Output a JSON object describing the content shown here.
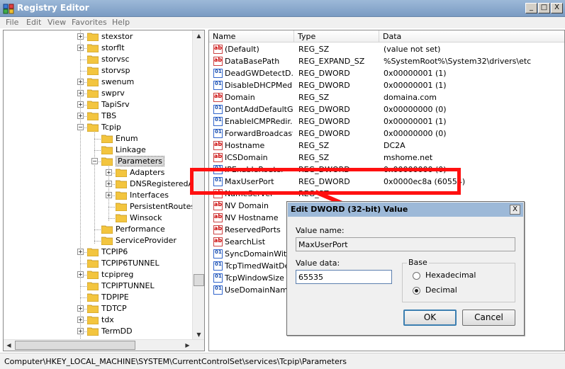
{
  "window": {
    "title": "Registry Editor",
    "buttons": {
      "minimize": "_",
      "maximize": "□",
      "close": "X"
    }
  },
  "menu": [
    "File",
    "Edit",
    "View",
    "Favorites",
    "Help"
  ],
  "tree": {
    "items": [
      {
        "label": "stexstor",
        "expander": "+"
      },
      {
        "label": "storflt",
        "expander": "+"
      },
      {
        "label": "storvsc",
        "expander": ""
      },
      {
        "label": "storvsp",
        "expander": ""
      },
      {
        "label": "swenum",
        "expander": "+"
      },
      {
        "label": "swprv",
        "expander": "+"
      },
      {
        "label": "TapiSrv",
        "expander": "+"
      },
      {
        "label": "TBS",
        "expander": "+"
      },
      {
        "label": "Tcpip",
        "expander": "−"
      },
      {
        "label": "Enum",
        "expander": ""
      },
      {
        "label": "Linkage",
        "expander": ""
      },
      {
        "label": "Parameters",
        "expander": "−"
      },
      {
        "label": "Adapters",
        "expander": "+"
      },
      {
        "label": "DNSRegisteredAd",
        "expander": "+"
      },
      {
        "label": "Interfaces",
        "expander": "+"
      },
      {
        "label": "PersistentRoutes",
        "expander": ""
      },
      {
        "label": "Winsock",
        "expander": ""
      },
      {
        "label": "Performance",
        "expander": ""
      },
      {
        "label": "ServiceProvider",
        "expander": ""
      },
      {
        "label": "TCPIP6",
        "expander": "+"
      },
      {
        "label": "TCPIP6TUNNEL",
        "expander": ""
      },
      {
        "label": "tcpipreg",
        "expander": "+"
      },
      {
        "label": "TCPIPTUNNEL",
        "expander": ""
      },
      {
        "label": "TDPIPE",
        "expander": ""
      },
      {
        "label": "TDTCP",
        "expander": "+"
      },
      {
        "label": "tdx",
        "expander": "+"
      },
      {
        "label": "TermDD",
        "expander": "+"
      }
    ],
    "selected": "Parameters"
  },
  "values_pane": {
    "columns": [
      "Name",
      "Type",
      "Data"
    ],
    "rows": [
      {
        "name": "(Default)",
        "type": "REG_SZ",
        "data": "(value not set)",
        "icon": "string-value-icon"
      },
      {
        "name": "DataBasePath",
        "type": "REG_EXPAND_SZ",
        "data": "%SystemRoot%\\System32\\drivers\\etc",
        "icon": "string-value-icon"
      },
      {
        "name": "DeadGWDetectD...",
        "type": "REG_DWORD",
        "data": "0x00000001 (1)",
        "icon": "dword-value-icon"
      },
      {
        "name": "DisableDHCPMedi...",
        "type": "REG_DWORD",
        "data": "0x00000001 (1)",
        "icon": "dword-value-icon"
      },
      {
        "name": "Domain",
        "type": "REG_SZ",
        "data": "domaina.com",
        "icon": "string-value-icon"
      },
      {
        "name": "DontAddDefaultG...",
        "type": "REG_DWORD",
        "data": "0x00000000 (0)",
        "icon": "dword-value-icon"
      },
      {
        "name": "EnableICMPRedir...",
        "type": "REG_DWORD",
        "data": "0x00000001 (1)",
        "icon": "dword-value-icon"
      },
      {
        "name": "ForwardBroadcasts",
        "type": "REG_DWORD",
        "data": "0x00000000 (0)",
        "icon": "dword-value-icon"
      },
      {
        "name": "Hostname",
        "type": "REG_SZ",
        "data": "DC2A",
        "icon": "string-value-icon"
      },
      {
        "name": "ICSDomain",
        "type": "REG_SZ",
        "data": "mshome.net",
        "icon": "string-value-icon"
      },
      {
        "name": "IPEnableRouter",
        "type": "REG_DWORD",
        "data": "0x00000000 (0)",
        "icon": "dword-value-icon"
      },
      {
        "name": "MaxUserPort",
        "type": "REG_DWORD",
        "data": "0x0000ec8a (60554)",
        "icon": "dword-value-icon"
      },
      {
        "name": "NameServer",
        "type": "REG_SZ",
        "data": "",
        "icon": "string-value-icon"
      },
      {
        "name": "NV Domain",
        "type": "",
        "data": "",
        "icon": "string-value-icon"
      },
      {
        "name": "NV Hostname",
        "type": "",
        "data": "",
        "icon": "string-value-icon"
      },
      {
        "name": "ReservedPorts",
        "type": "",
        "data": "",
        "icon": "string-value-icon"
      },
      {
        "name": "SearchList",
        "type": "",
        "data": "",
        "icon": "string-value-icon"
      },
      {
        "name": "SyncDomainWith...",
        "type": "",
        "data": "",
        "icon": "dword-value-icon"
      },
      {
        "name": "TcpTimedWaitDela",
        "type": "",
        "data": "",
        "icon": "dword-value-icon"
      },
      {
        "name": "TcpWindowSize",
        "type": "",
        "data": "",
        "icon": "dword-value-icon"
      },
      {
        "name": "UseDomainName...",
        "type": "",
        "data": "",
        "icon": "dword-value-icon"
      }
    ]
  },
  "status_bar": "Computer\\HKEY_LOCAL_MACHINE\\SYSTEM\\CurrentControlSet\\services\\Tcpip\\Parameters",
  "dialog": {
    "title": "Edit DWORD (32-bit) Value",
    "value_name_label": "Value name:",
    "value_name": "MaxUserPort",
    "value_data_label": "Value data:",
    "value_data": "65535",
    "base_label": "Base",
    "base_options": [
      "Hexadecimal",
      "Decimal"
    ],
    "base_selected": "Decimal",
    "ok_label": "OK",
    "cancel_label": "Cancel",
    "close_glyph": "X"
  },
  "annotation_color": "#ff1010"
}
